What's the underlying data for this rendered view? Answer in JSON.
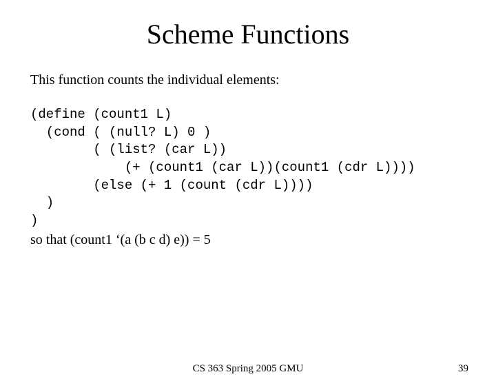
{
  "title": "Scheme Functions",
  "intro": "This function counts the individual elements:",
  "code": "(define (count1 L)\n  (cond ( (null? L) 0 )\n        ( (list? (car L))\n            (+ (count1 (car L))(count1 (cdr L))))\n        (else (+ 1 (count (cdr L))))\n  )\n)",
  "after": "so that (count1 ‘(a (b c d) e)) = 5",
  "footer_center": "CS 363 Spring 2005 GMU",
  "footer_right": "39"
}
